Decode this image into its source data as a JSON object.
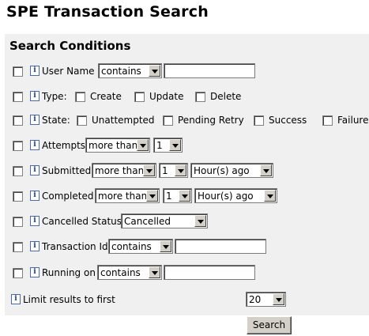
{
  "page": {
    "title": "SPE Transaction Search"
  },
  "section": {
    "title": "Search Conditions"
  },
  "info_glyph": "i",
  "user_name": {
    "label": "User Name",
    "operator": "contains",
    "value": ""
  },
  "type": {
    "label": "Type:",
    "options": [
      "Create",
      "Update",
      "Delete"
    ]
  },
  "state": {
    "label": "State:",
    "options": [
      "Unattempted",
      "Pending Retry",
      "Success",
      "Failure"
    ]
  },
  "attempts": {
    "label": "Attempts",
    "operator": "more than",
    "value": "1"
  },
  "submitted": {
    "label": "Submitted",
    "operator": "more than",
    "value": "1",
    "unit": "Hour(s) ago"
  },
  "completed": {
    "label": "Completed",
    "operator": "more than",
    "value": "1",
    "unit": "Hour(s) ago"
  },
  "cancelled": {
    "label": "Cancelled Status",
    "value": "Cancelled"
  },
  "transaction_id": {
    "label": "Transaction Id",
    "operator": "contains",
    "value": ""
  },
  "running_on": {
    "label": "Running on",
    "operator": "contains",
    "value": ""
  },
  "limit": {
    "label": "Limit results to first",
    "value": "20"
  },
  "search_button": {
    "label": "Search"
  }
}
